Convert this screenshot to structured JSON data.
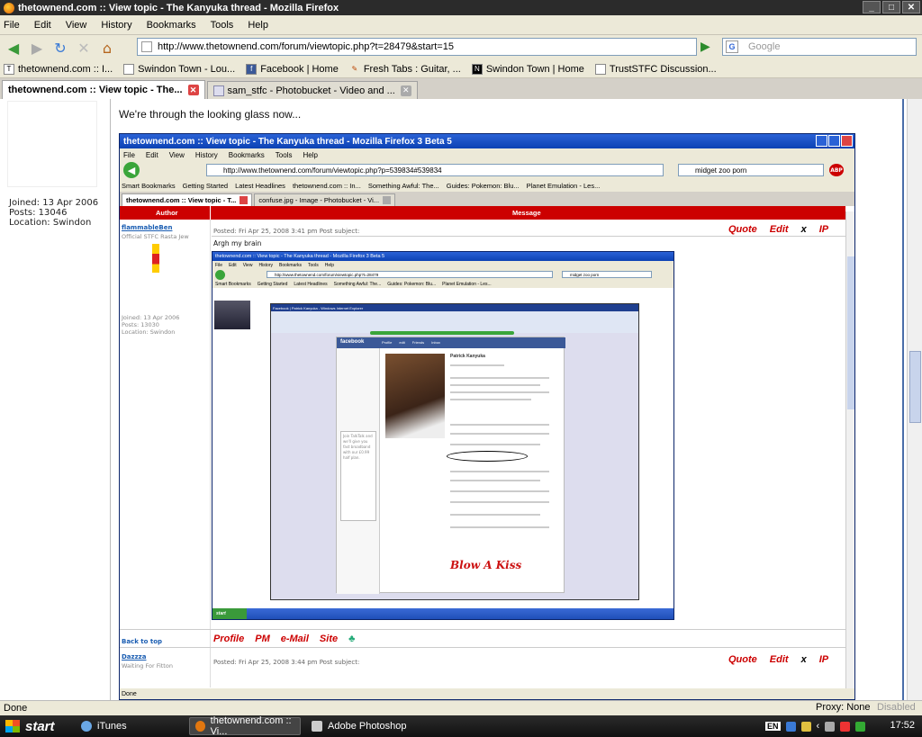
{
  "window": {
    "title": "thetownend.com :: View topic - The Kanyuka thread - Mozilla Firefox"
  },
  "menu": [
    "File",
    "Edit",
    "View",
    "History",
    "Bookmarks",
    "Tools",
    "Help"
  ],
  "nav": {
    "url": "http://www.thetownend.com/forum/viewtopic.php?t=28479&start=15",
    "search_placeholder": "Google",
    "search_engine_letter": "G"
  },
  "bookmarks": [
    "thetownend.com :: I...",
    "Swindon Town - Lou...",
    "Facebook | Home",
    "Fresh Tabs : Guitar, ...",
    "Swindon Town | Home",
    "TrustSTFC Discussion..."
  ],
  "tabs": [
    {
      "label": "thetownend.com :: View topic - The...",
      "active": true
    },
    {
      "label": "sam_stfc - Photobucket - Video and ...",
      "active": false
    }
  ],
  "user": {
    "joined": "Joined: 13 Apr 2006",
    "posts": "Posts: 13046",
    "location": "Location: Swindon"
  },
  "signature": "We're through the looking glass now...",
  "inner1": {
    "title": "thetownend.com :: View topic - The Kanyuka thread - Mozilla Firefox 3 Beta 5",
    "menu": [
      "File",
      "Edit",
      "View",
      "History",
      "Bookmarks",
      "Tools",
      "Help"
    ],
    "url": "http://www.thetownend.com/forum/viewtopic.php?p=539834#539834",
    "search": "midget zoo porn",
    "abp": "ABP",
    "bookmarks": [
      "Smart Bookmarks",
      "Getting Started",
      "Latest Headlines",
      "thetownend.com :: In...",
      "Something Awful: The...",
      "Guides: Pokemon: Blu...",
      "Planet Emulation - Les..."
    ],
    "tabs": [
      "thetownend.com :: View topic - T...",
      "confuse.jpg - Image - Photobucket - Vi..."
    ],
    "table_header": {
      "author": "Author",
      "message": "Message"
    },
    "post1": {
      "author": "flammableBen",
      "rank": "Official STFC Rasta Jew",
      "joined": "Joined: 13 Apr 2006",
      "posts": "Posts: 13030",
      "location": "Location: Swindon",
      "meta": "Posted: Fri Apr 25, 2008 3:41 pm    Post subject:",
      "body": "Argh my brain"
    },
    "actions": {
      "quote": "Quote",
      "edit": "Edit",
      "x": "x",
      "ip": "IP"
    },
    "profile_buttons": {
      "profile": "Profile",
      "pm": "PM",
      "email": "e-Mail",
      "site": "Site"
    },
    "back_to_top": "Back to top",
    "post2": {
      "author": "Dazzza",
      "rank": "Waiting For Fitton",
      "meta": "Posted: Fri Apr 25, 2008 3:44 pm    Post subject:"
    },
    "status": "Done"
  },
  "inner2": {
    "title": "thetownend.com :: View topic - The Kanyuka thread - Mozilla Firefox 3 Beta 5",
    "url": "http://www.thetownend.com/forum/viewtopic.php?t=28479",
    "search": "midget zoo porn",
    "bookmarks": [
      "Smart Bookmarks",
      "Getting Started",
      "Latest Headlines",
      "Something Awful: The...",
      "Guides: Pokemon: Blu...",
      "Planet Emulation - Les..."
    ],
    "start": "start"
  },
  "inner3": {
    "title": "Facebook | Patrick Kanyuka - Windows Internet Explorer",
    "logo": "facebook",
    "fb_nav": [
      "Profile",
      "edit",
      "Friends",
      "Inbox"
    ],
    "name": "Patrick Kanyuka",
    "ad_text": "Join TalkTalk and we'll give you fast broadband with our £0.99 half plan.",
    "blow": "Blow A Kiss"
  },
  "status": {
    "text": "Done",
    "proxy": "Proxy: None",
    "disabled": "Disabled"
  },
  "taskbar": {
    "start": "start",
    "items": [
      "iTunes",
      "thetownend.com :: Vi...",
      "Adobe Photoshop"
    ],
    "lang": "EN",
    "clock": "17:52"
  }
}
